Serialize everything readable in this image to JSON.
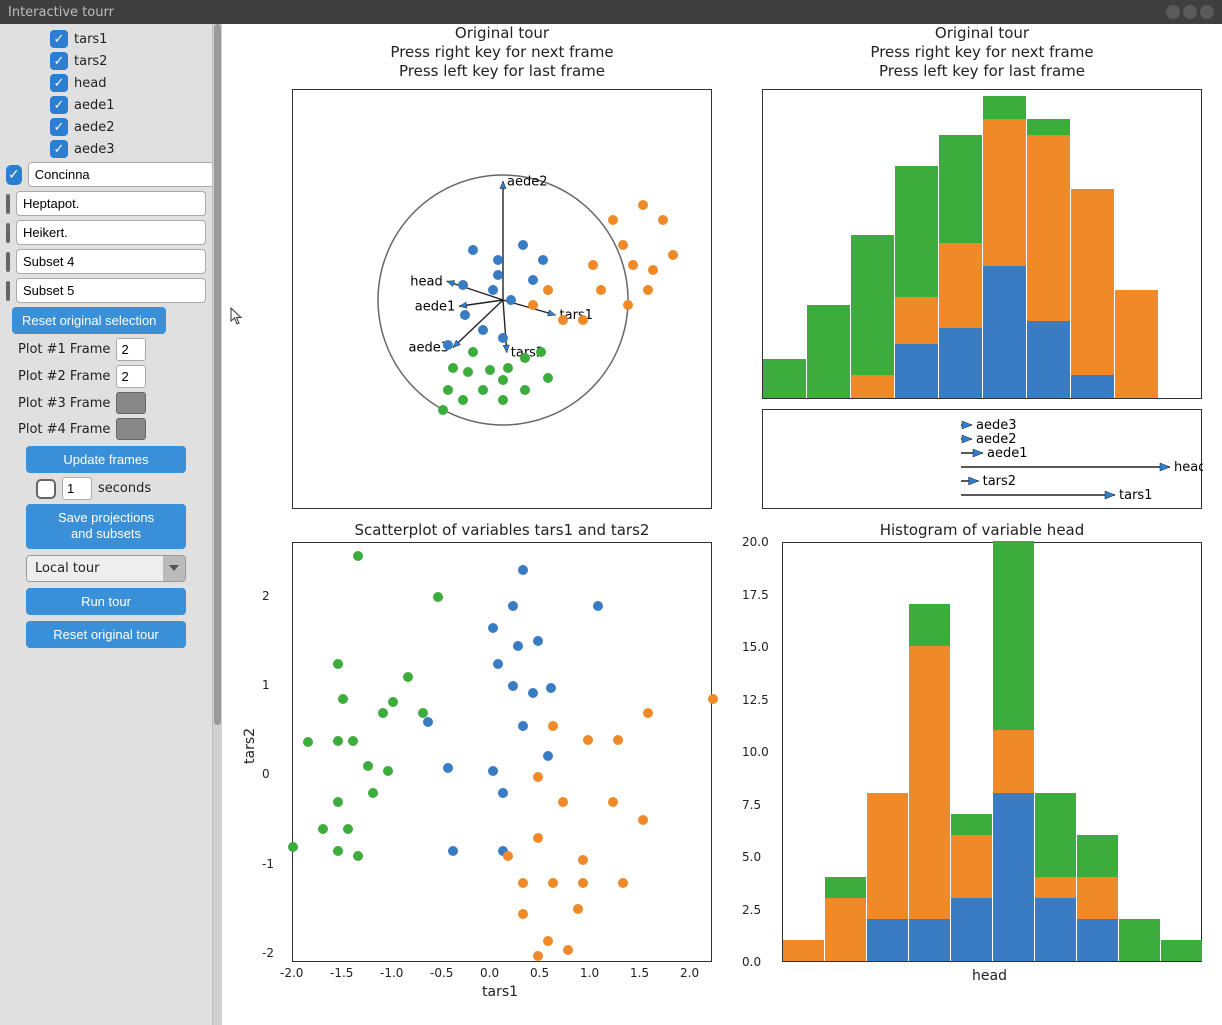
{
  "window": {
    "title": "Interactive tourr"
  },
  "colors": {
    "blue": "#3a7cc4",
    "orange": "#f08a28",
    "green": "#3cad3c",
    "red": "#c73232",
    "purple": "#a36bc7"
  },
  "sidebar": {
    "variables": [
      {
        "label": "tars1",
        "checked": true
      },
      {
        "label": "tars2",
        "checked": true
      },
      {
        "label": "head",
        "checked": true
      },
      {
        "label": "aede1",
        "checked": true
      },
      {
        "label": "aede2",
        "checked": true
      },
      {
        "label": "aede3",
        "checked": true
      }
    ],
    "subsets": [
      {
        "label": "Concinna",
        "checked": true,
        "color": "#2c7fd0"
      },
      {
        "label": "Heptapot.",
        "checked": false,
        "color": "#f08a28"
      },
      {
        "label": "Heikert.",
        "checked": false,
        "color": "#3cad3c"
      },
      {
        "label": "Subset 4",
        "checked": false,
        "color": "#c73232"
      },
      {
        "label": "Subset 5",
        "checked": false,
        "color": "#a36bc7"
      }
    ],
    "reset_selection": "Reset original selection",
    "frames": [
      {
        "label": "Plot #1 Frame",
        "value": "2"
      },
      {
        "label": "Plot #2 Frame",
        "value": "2"
      },
      {
        "label": "Plot #3 Frame",
        "value": ""
      },
      {
        "label": "Plot #4 Frame",
        "value": ""
      }
    ],
    "update_frames": "Update frames",
    "seconds_value": "1",
    "seconds_label": "seconds",
    "save_projections": "Save projections\nand subsets",
    "tour_type": "Local tour",
    "run_tour": "Run tour",
    "reset_tour": "Reset original tour"
  },
  "plots": {
    "tour_title": "Original tour\nPress right key for next frame\nPress left key for last frame",
    "scatter_title": "Scatterplot of variables tars1 and tars2",
    "hist_title": "Histogram of variable head",
    "scatter_xlabel": "tars1",
    "scatter_ylabel": "tars2",
    "hist_xlabel": "head",
    "tour_axis_labels": [
      "tars1",
      "tars2",
      "head",
      "aede1",
      "aede2",
      "aede3"
    ]
  },
  "chart_data": [
    {
      "id": "tour-axes-top-left",
      "type": "biplot",
      "title": "Original tour",
      "axes": [
        {
          "name": "tars1",
          "dx": 0.42,
          "dy": -0.12
        },
        {
          "name": "tars2",
          "dx": 0.03,
          "dy": -0.42
        },
        {
          "name": "head",
          "dx": -0.45,
          "dy": 0.15
        },
        {
          "name": "aede1",
          "dx": -0.35,
          "dy": -0.05
        },
        {
          "name": "aede2",
          "dx": 0.0,
          "dy": 0.95
        },
        {
          "name": "aede3",
          "dx": -0.4,
          "dy": -0.38
        }
      ]
    },
    {
      "id": "tour-hist-top-right",
      "type": "bar",
      "title": "Original tour",
      "bins": 10,
      "stacks": [
        "blue",
        "orange",
        "green"
      ],
      "values": [
        [
          0,
          0,
          5
        ],
        [
          0,
          0,
          12
        ],
        [
          0,
          3,
          21
        ],
        [
          7,
          13,
          30
        ],
        [
          9,
          20,
          34
        ],
        [
          17,
          36,
          39
        ],
        [
          10,
          34,
          36
        ],
        [
          3,
          27,
          27
        ],
        [
          0,
          14,
          14
        ],
        [
          0,
          0,
          0
        ]
      ],
      "ylim": [
        0,
        40
      ]
    },
    {
      "id": "tour-axes-mid-right",
      "type": "biplot-1d",
      "axes": [
        {
          "name": "aede3",
          "len": 0.05
        },
        {
          "name": "aede2",
          "len": 0.05
        },
        {
          "name": "aede1",
          "len": 0.1
        },
        {
          "name": "head",
          "len": 0.95
        },
        {
          "name": "tars2",
          "len": 0.08
        },
        {
          "name": "tars1",
          "len": 0.7
        }
      ]
    },
    {
      "id": "scatter-bottom-left",
      "type": "scatter",
      "title": "Scatterplot of variables tars1 and tars2",
      "xlabel": "tars1",
      "ylabel": "tars2",
      "xlim": [
        -2.0,
        2.2
      ],
      "ylim": [
        -2.1,
        2.6
      ],
      "xticks": [
        -2.0,
        -1.5,
        -1.0,
        -0.5,
        0.0,
        0.5,
        1.0,
        1.5,
        2.0
      ],
      "yticks": [
        -2,
        -1,
        0,
        1,
        2
      ],
      "series": [
        {
          "name": "green",
          "points": [
            [
              -1.35,
              2.45
            ],
            [
              -0.55,
              2.0
            ],
            [
              -1.55,
              1.25
            ],
            [
              -0.85,
              1.1
            ],
            [
              -1.5,
              0.85
            ],
            [
              -1.0,
              0.82
            ],
            [
              -1.1,
              0.7
            ],
            [
              -0.7,
              0.7
            ],
            [
              -1.85,
              0.37
            ],
            [
              -1.55,
              0.38
            ],
            [
              -1.4,
              0.38
            ],
            [
              -1.25,
              0.1
            ],
            [
              -1.05,
              0.05
            ],
            [
              -1.2,
              -0.2
            ],
            [
              -1.55,
              -0.3
            ],
            [
              -2.0,
              -0.8
            ],
            [
              -1.7,
              -0.6
            ],
            [
              -1.45,
              -0.6
            ],
            [
              -1.55,
              -0.85
            ],
            [
              -1.35,
              -0.9
            ]
          ]
        },
        {
          "name": "blue",
          "points": [
            [
              0.3,
              2.3
            ],
            [
              0.2,
              1.9
            ],
            [
              1.05,
              1.9
            ],
            [
              0.0,
              1.65
            ],
            [
              0.25,
              1.45
            ],
            [
              0.45,
              1.5
            ],
            [
              0.05,
              1.25
            ],
            [
              0.2,
              1.0
            ],
            [
              0.4,
              0.92
            ],
            [
              0.58,
              0.98
            ],
            [
              -0.65,
              0.6
            ],
            [
              0.3,
              0.55
            ],
            [
              0.0,
              0.05
            ],
            [
              -0.45,
              0.08
            ],
            [
              -0.4,
              -0.85
            ],
            [
              0.1,
              -0.85
            ],
            [
              0.55,
              0.22
            ],
            [
              0.1,
              -0.2
            ]
          ]
        },
        {
          "name": "orange",
          "points": [
            [
              2.2,
              0.85
            ],
            [
              1.55,
              0.7
            ],
            [
              0.6,
              0.55
            ],
            [
              0.95,
              0.4
            ],
            [
              1.25,
              0.4
            ],
            [
              0.45,
              -0.02
            ],
            [
              0.7,
              -0.3
            ],
            [
              1.2,
              -0.3
            ],
            [
              1.5,
              -0.5
            ],
            [
              0.45,
              -0.7
            ],
            [
              0.15,
              -0.9
            ],
            [
              0.9,
              -0.95
            ],
            [
              0.3,
              -1.2
            ],
            [
              0.6,
              -1.2
            ],
            [
              0.9,
              -1.2
            ],
            [
              1.3,
              -1.2
            ],
            [
              0.3,
              -1.55
            ],
            [
              0.85,
              -1.5
            ],
            [
              0.55,
              -1.85
            ],
            [
              0.45,
              -2.02
            ],
            [
              0.75,
              -1.95
            ]
          ]
        }
      ]
    },
    {
      "id": "hist-bottom-right",
      "type": "bar",
      "title": "Histogram of variable head",
      "xlabel": "head",
      "ylim": [
        0,
        20
      ],
      "yticks": [
        0.0,
        2.5,
        5.0,
        7.5,
        10.0,
        12.5,
        15.0,
        17.5,
        20.0
      ],
      "categories": [
        "b0",
        "b1",
        "b2",
        "b3",
        "b4",
        "b5",
        "b6",
        "b7",
        "b8",
        "b9"
      ],
      "stacks": [
        "blue",
        "orange",
        "green"
      ],
      "values": [
        [
          0,
          1,
          0
        ],
        [
          0,
          3,
          4
        ],
        [
          2,
          8,
          8
        ],
        [
          2,
          15,
          17
        ],
        [
          3,
          6,
          7
        ],
        [
          8,
          11,
          20
        ],
        [
          3,
          4,
          8
        ],
        [
          2,
          4,
          6
        ],
        [
          0,
          0,
          2
        ],
        [
          0,
          0,
          1
        ]
      ]
    }
  ]
}
